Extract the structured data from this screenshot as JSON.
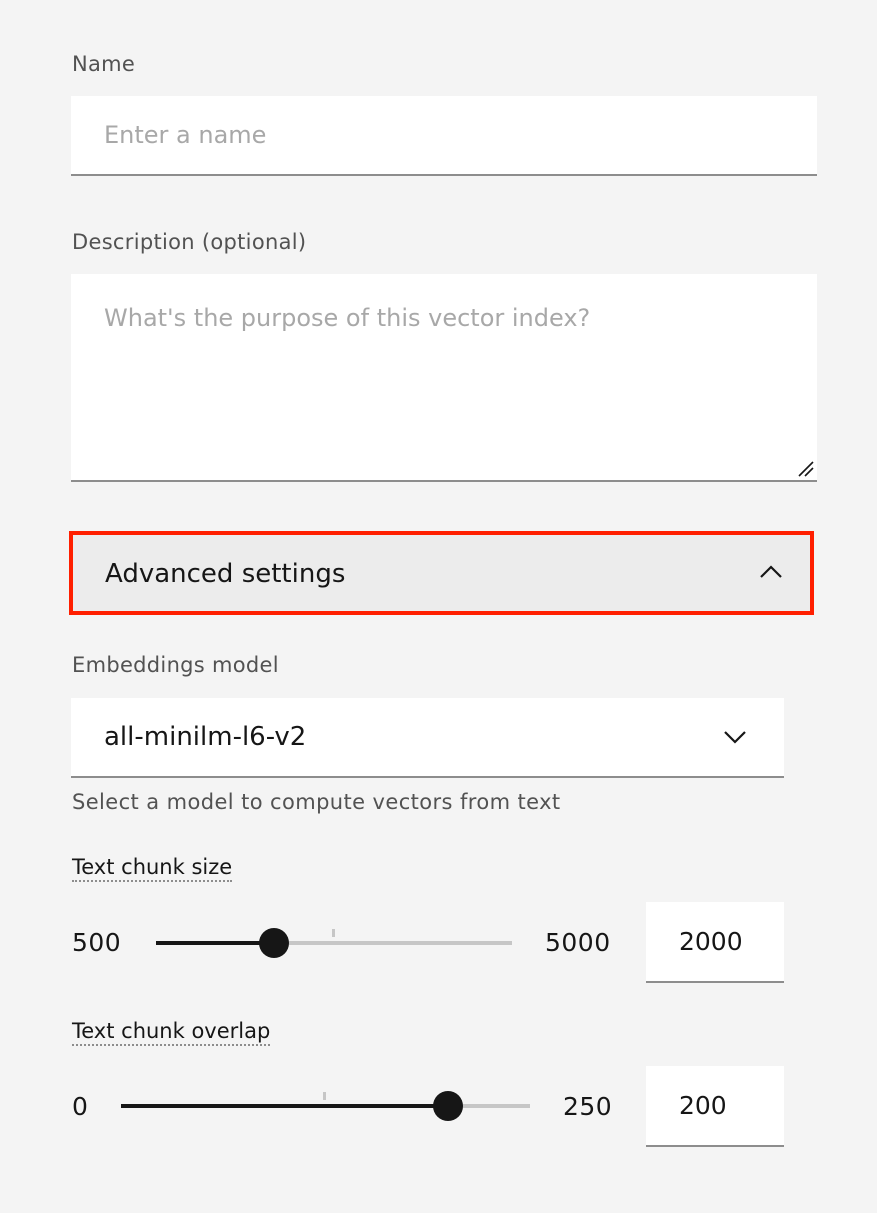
{
  "form": {
    "name": {
      "label": "Name",
      "placeholder": "Enter a name",
      "value": ""
    },
    "description": {
      "label": "Description (optional)",
      "placeholder": "What's the purpose of this vector index?",
      "value": ""
    }
  },
  "advanced": {
    "title": "Advanced settings",
    "expanded": true,
    "embeddings": {
      "label": "Embeddings model",
      "selected": "all-minilm-l6-v2",
      "helper": "Select a model to compute vectors from text"
    },
    "chunk_size": {
      "label": "Text chunk size",
      "min": "500",
      "max": "5000",
      "value": "2000"
    },
    "chunk_overlap": {
      "label": "Text chunk overlap",
      "min": "0",
      "max": "250",
      "value": "200"
    }
  },
  "colors": {
    "background": "#f4f4f4",
    "highlight": "#ff1f00",
    "text": "#161616"
  },
  "icons": {
    "accordion": "chevron-up-icon",
    "select": "chevron-down-icon",
    "textarea": "resize-grip-icon"
  }
}
